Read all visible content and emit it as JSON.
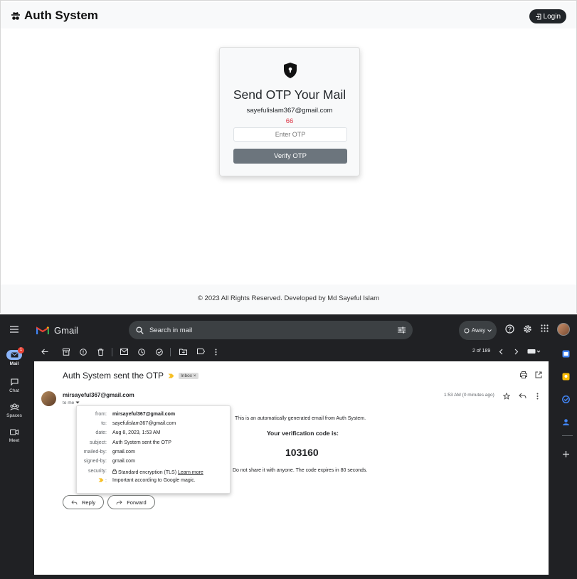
{
  "app": {
    "brand": "Auth System",
    "login_label": "Login",
    "card": {
      "title": "Send OTP Your Mail",
      "email": "sayefulislam367@gmail.com",
      "timer": "66",
      "otp_placeholder": "Enter OTP",
      "verify_label": "Verify OTP"
    },
    "footer": "© 2023 All Rights Reserved. Developed by Md Sayeful Islam"
  },
  "gmail": {
    "logo_text": "Gmail",
    "search_placeholder": "Search in mail",
    "status": "Away",
    "nav": [
      {
        "label": "Mail",
        "badge": "1"
      },
      {
        "label": "Chat"
      },
      {
        "label": "Spaces"
      },
      {
        "label": "Meet"
      }
    ],
    "page_count": "2 of 189",
    "email": {
      "subject": "Auth System sent the OTP",
      "label_chip": "Inbox ×",
      "sender": "mirsayeful367@gmail.com",
      "to_me": "to me",
      "time": "1:53 AM (0 minutes ago)",
      "intro": "This is an automatically generated email from Auth System.",
      "code_label": "Your verification code is:",
      "code": "103160",
      "warning": "Do not share it with anyone. The code expires in 80 seconds.",
      "details": {
        "from_k": "from:",
        "from_v": "mirsayeful367@gmail.com",
        "to_k": "to:",
        "to_v": "sayefulislam367@gmail.com",
        "date_k": "date:",
        "date_v": "Aug 8, 2023, 1:53 AM",
        "subject_k": "subject:",
        "subject_v": "Auth System sent the OTP",
        "mailedby_k": "mailed-by:",
        "mailedby_v": "gmail.com",
        "signedby_k": "signed-by:",
        "signedby_v": "gmail.com",
        "security_k": "security:",
        "security_v": "Standard encryption (TLS)",
        "learn_more": "Learn more",
        "important_v": "Important according to Google magic."
      },
      "reply_label": "Reply",
      "forward_label": "Forward"
    }
  }
}
